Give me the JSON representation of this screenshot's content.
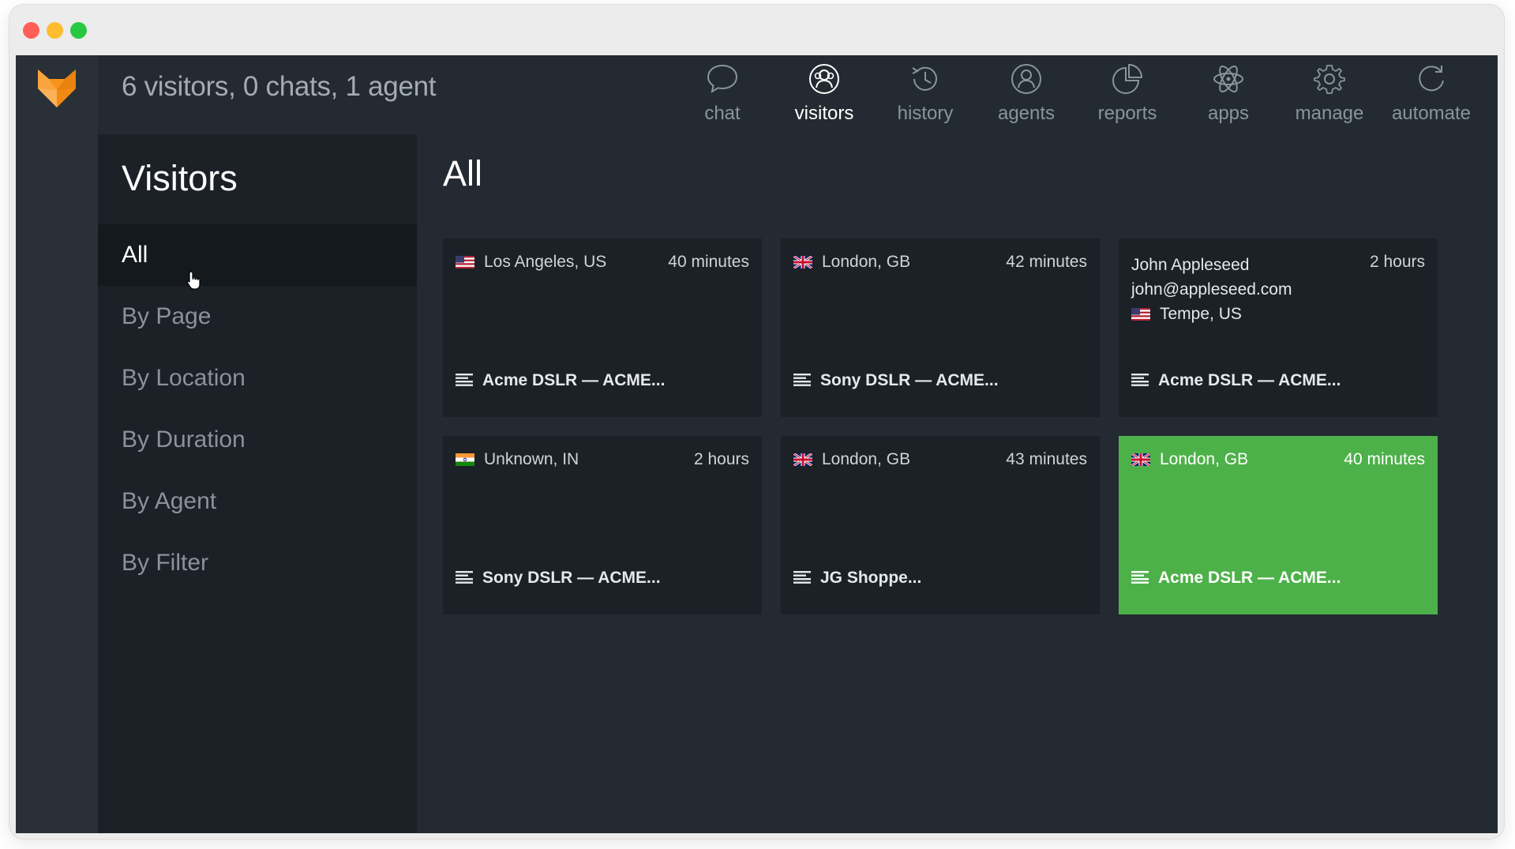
{
  "window": {
    "controls": [
      "close",
      "minimize",
      "zoom"
    ]
  },
  "header": {
    "status_text": "6 visitors, 0 chats, 1 agent",
    "nav": [
      {
        "label": "chat",
        "icon": "chat-bubble-icon"
      },
      {
        "label": "visitors",
        "icon": "visitors-icon",
        "active": true
      },
      {
        "label": "history",
        "icon": "history-clock-icon"
      },
      {
        "label": "agents",
        "icon": "agent-person-icon"
      },
      {
        "label": "reports",
        "icon": "pie-chart-icon"
      },
      {
        "label": "apps",
        "icon": "atom-icon"
      },
      {
        "label": "manage",
        "icon": "gear-icon"
      },
      {
        "label": "automate",
        "icon": "refresh-icon"
      }
    ]
  },
  "sidebar": {
    "title": "Visitors",
    "items": [
      {
        "label": "All",
        "active": true
      },
      {
        "label": "By Page"
      },
      {
        "label": "By Location"
      },
      {
        "label": "By Duration"
      },
      {
        "label": "By Agent"
      },
      {
        "label": "By Filter"
      }
    ]
  },
  "main": {
    "title": "All",
    "visitors": [
      {
        "location": "Los Angeles, US",
        "flag": "us-flag-icon",
        "duration": "40 minutes",
        "page": "Acme DSLR — ACME..."
      },
      {
        "location": "London, GB",
        "flag": "gb-flag-icon",
        "duration": "42 minutes",
        "page": "Sony DSLR — ACME..."
      },
      {
        "name": "John Appleseed",
        "email": "john@appleseed.com",
        "location": "Tempe, US",
        "flag": "us-flag-icon",
        "duration": "2 hours",
        "page": "Acme DSLR — ACME..."
      },
      {
        "location": "Unknown, IN",
        "flag": "in-flag-icon",
        "duration": "2 hours",
        "page": "Sony DSLR — ACME..."
      },
      {
        "location": "London, GB",
        "flag": "gb-flag-icon",
        "duration": "43 minutes",
        "page": "JG Shoppe..."
      },
      {
        "location": "London, GB",
        "flag": "gb-flag-icon",
        "duration": "40 minutes",
        "page": "Acme DSLR — ACME...",
        "highlighted": true
      }
    ]
  },
  "colors": {
    "app_background": "#232a31",
    "sidebar_background": "#1b2127",
    "card_background": "#1b2127",
    "highlight_green": "#4db14a",
    "logo_orange": "#f7941d"
  }
}
